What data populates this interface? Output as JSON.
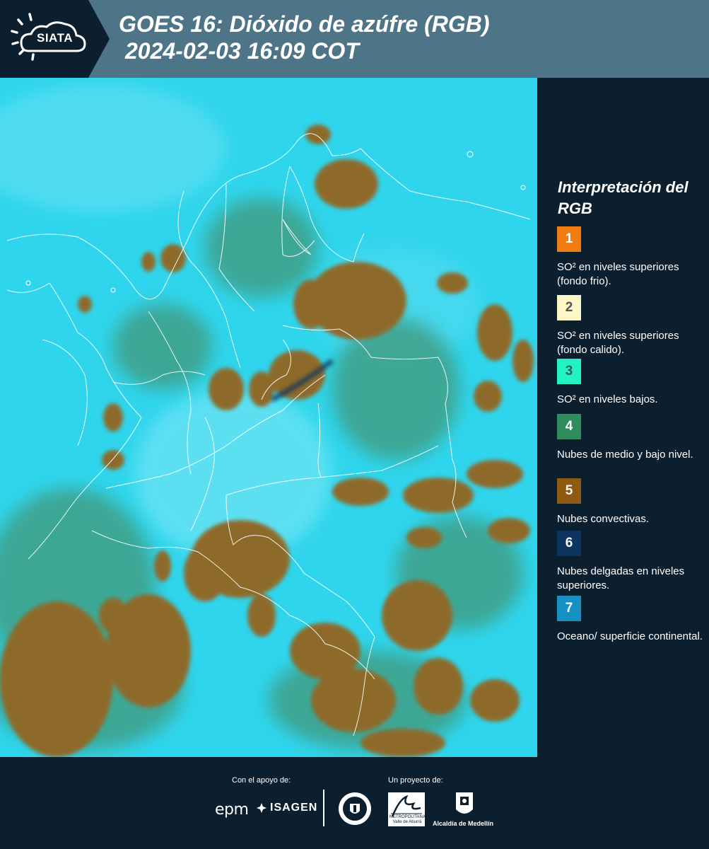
{
  "header": {
    "logo_text": "SIATA",
    "title_line1": "GOES 16: Dióxido de azúfre (RGB)",
    "title_line2": "2024-02-03 16:09 COT"
  },
  "legend": {
    "title": "Interpretación del RGB",
    "items": [
      {
        "number": "1",
        "color": "#f07d12",
        "text": "SO² en niveles superiores (fondo frio)."
      },
      {
        "number": "2",
        "color": "#fdf6c6",
        "text": "SO² en niveles superiores (fondo calido)."
      },
      {
        "number": "3",
        "color": "#22f2c4",
        "text": "SO² en niveles bajos."
      },
      {
        "number": "4",
        "color": "#2f8c5c",
        "text": "Nubes de medio y bajo nivel."
      },
      {
        "number": "5",
        "color": "#8e5a12",
        "text": "Nubes convectivas."
      },
      {
        "number": "6",
        "color": "#0d3560",
        "text": "Nubes delgadas en niveles superiores."
      },
      {
        "number": "7",
        "color": "#1491c2",
        "text": "Oceano/ superficie continental."
      }
    ]
  },
  "footer": {
    "support_label": "Con el apoyo de:",
    "project_label": "Un proyecto de:",
    "epm": "epm",
    "isagen": "ISAGEN",
    "area_text": "METROPOLITANA Valle de Aburrá",
    "alcaldia": "Alcaldía de Medellín"
  },
  "colors": {
    "header_bg": "#4d7587",
    "panel_bg": "#0c1f2e",
    "map_background": "#2fd5ec",
    "cloud_convective": "#8e6a2a",
    "cloud_low": "#3f9f86"
  }
}
